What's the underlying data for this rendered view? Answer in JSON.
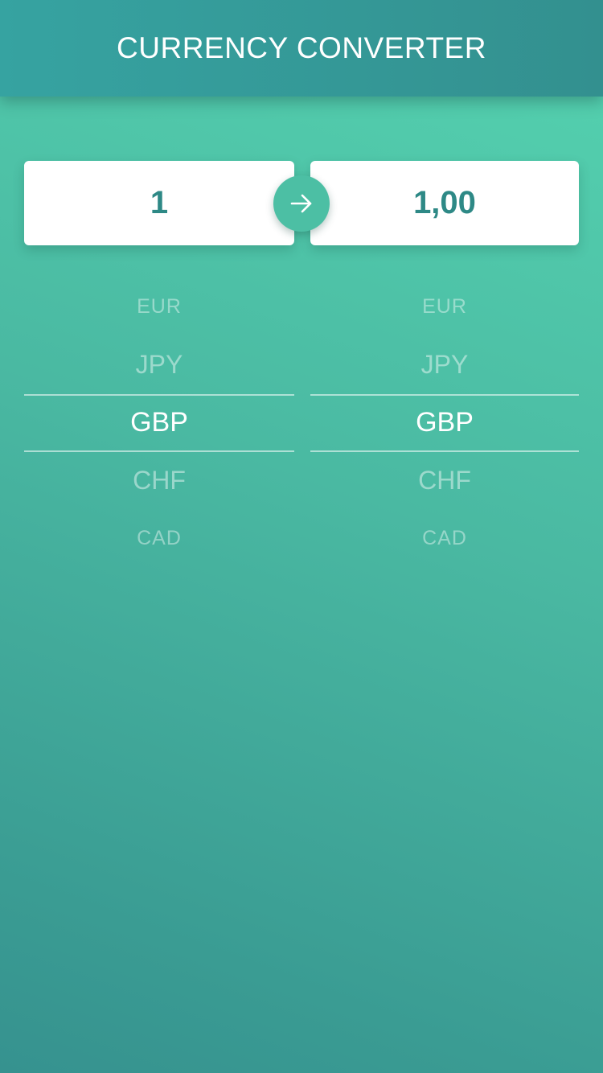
{
  "header": {
    "title": "CURRENCY CONVERTER"
  },
  "converter": {
    "from_amount": "1",
    "to_amount": "1,00",
    "convert_icon": "arrow-right-icon"
  },
  "pickers": {
    "from": {
      "items": [
        "EUR",
        "JPY",
        "GBP",
        "CHF",
        "CAD"
      ],
      "selected": "GBP"
    },
    "to": {
      "items": [
        "EUR",
        "JPY",
        "GBP",
        "CHF",
        "CAD"
      ],
      "selected": "GBP"
    }
  },
  "colors": {
    "header_bg": "#3399a0",
    "accent_button": "#4cbfa4",
    "amount_text": "#2e8986"
  }
}
